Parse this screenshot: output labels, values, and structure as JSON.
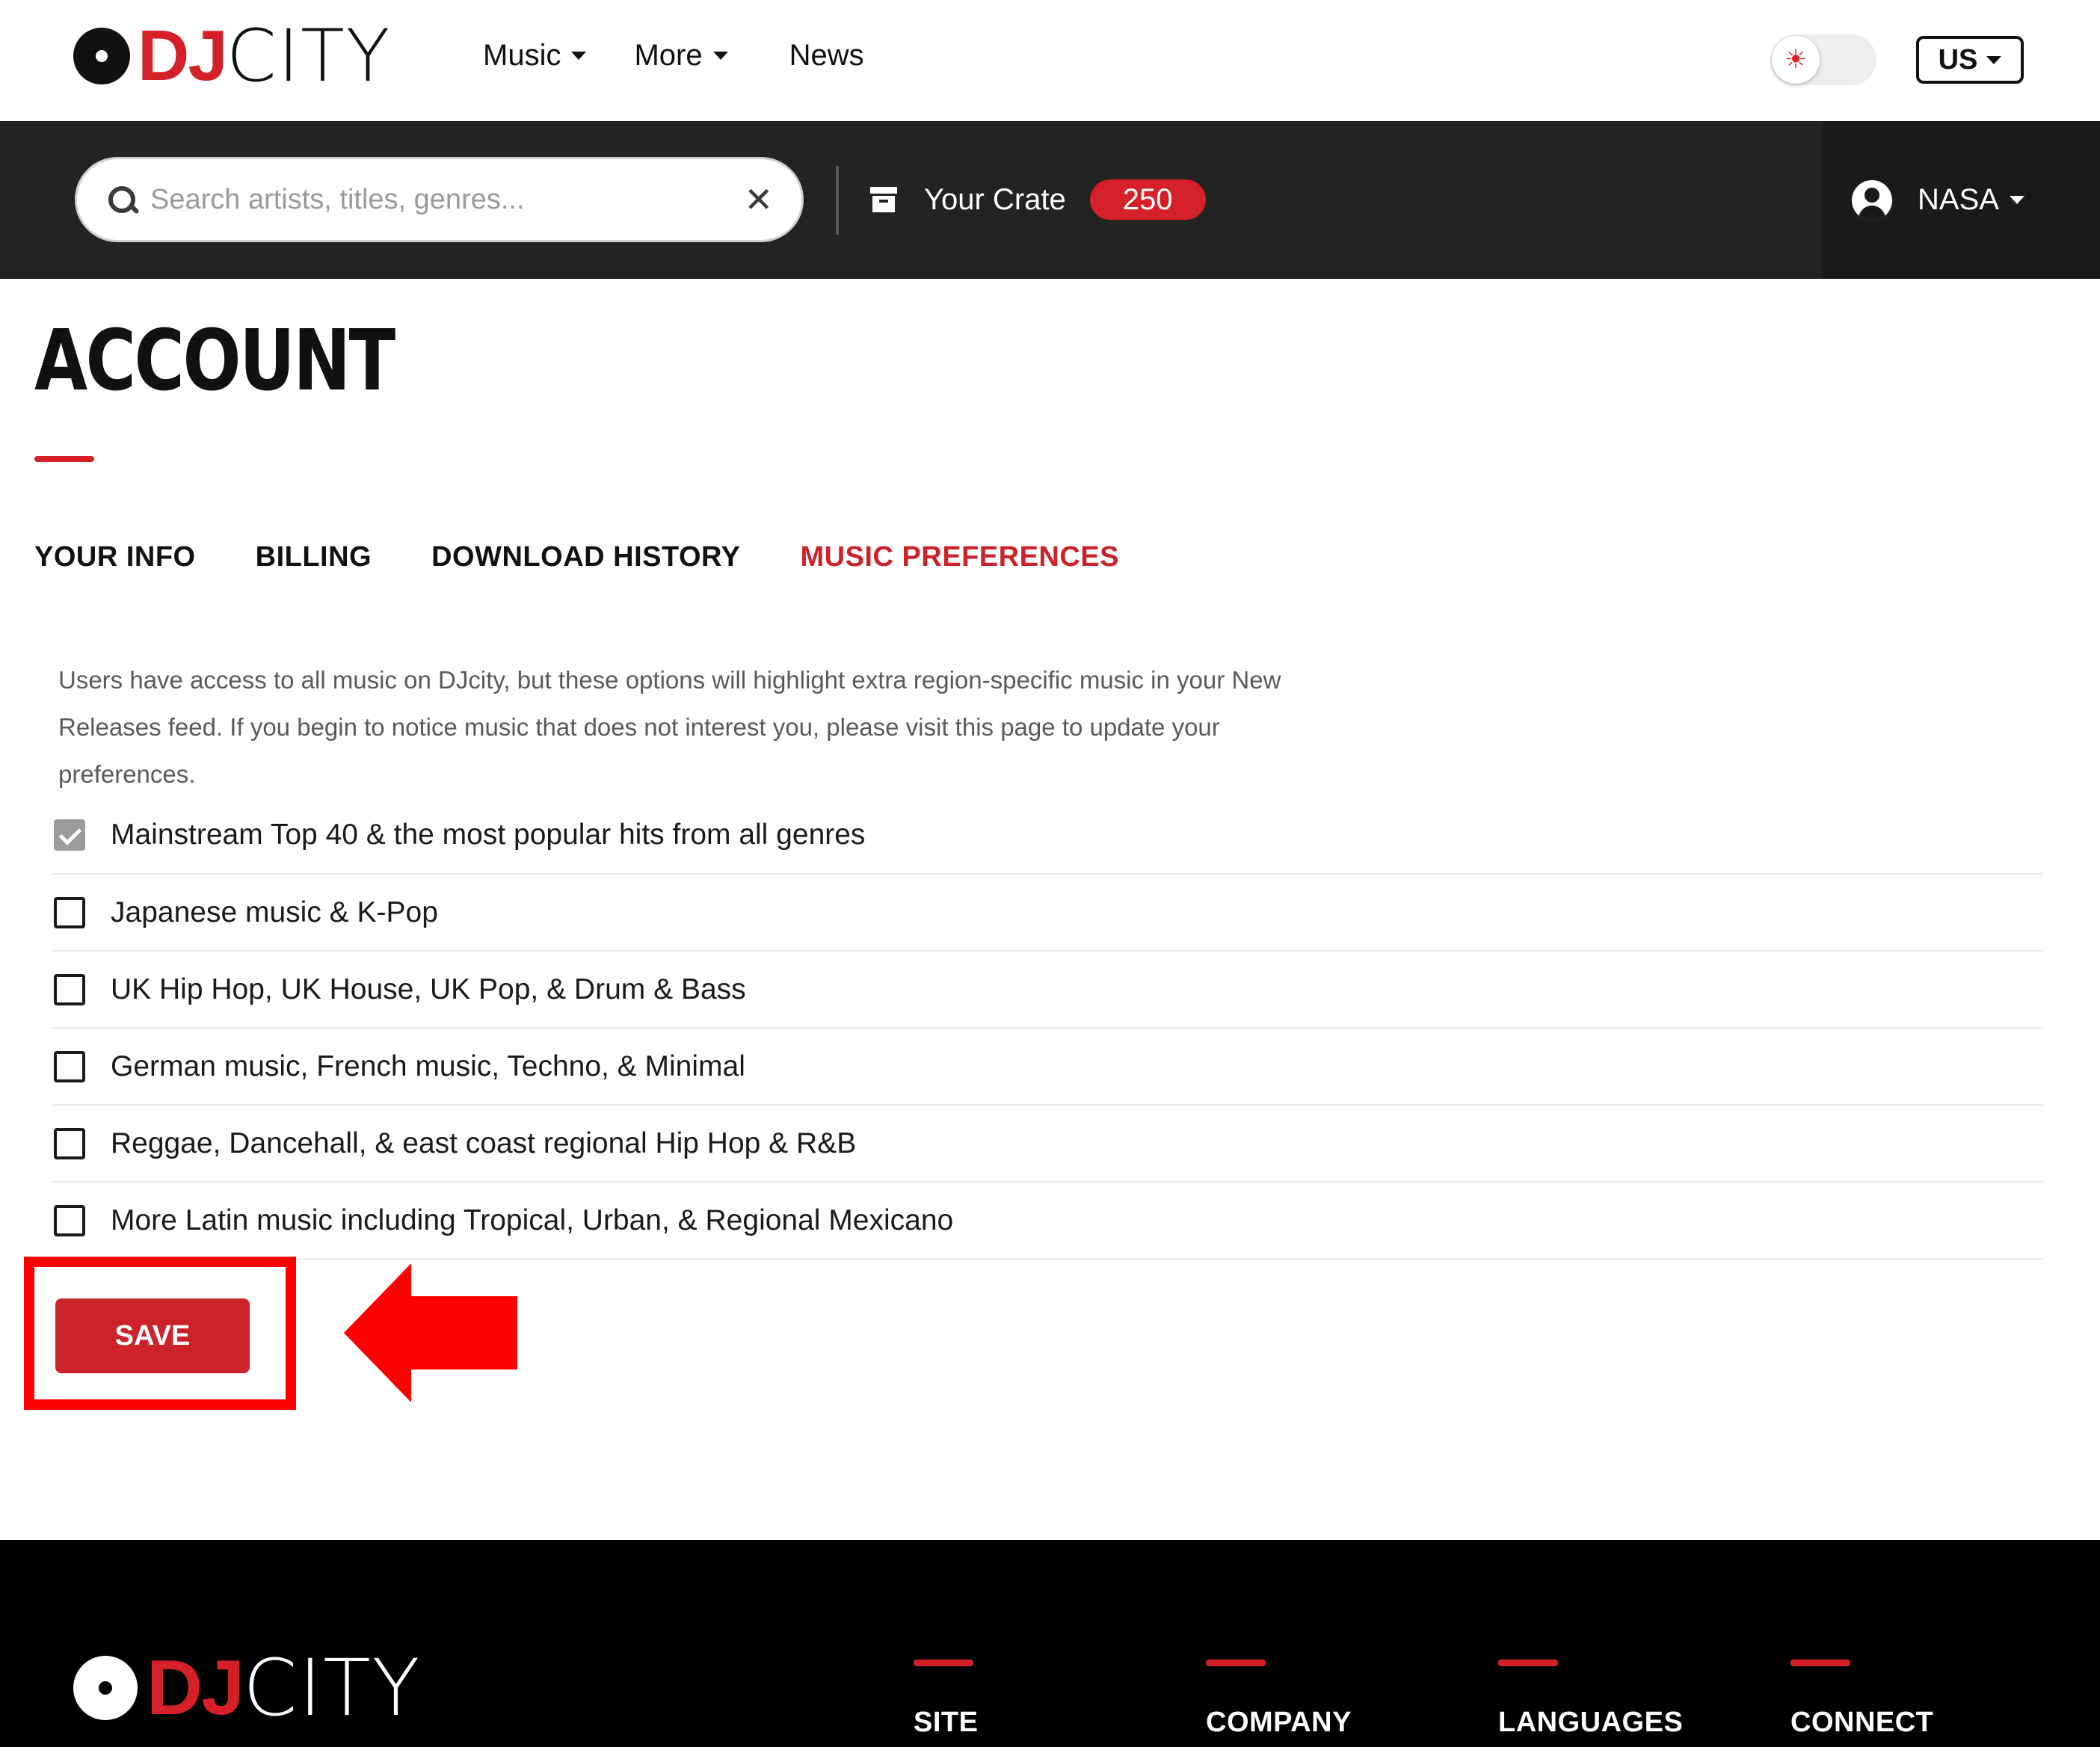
{
  "brand": {
    "logo_dj": "DJ",
    "logo_city": "CITY"
  },
  "topnav": {
    "items": [
      {
        "label": "Music",
        "dropdown": true
      },
      {
        "label": "More",
        "dropdown": true
      },
      {
        "label": "News",
        "dropdown": false
      }
    ]
  },
  "theme_toggle": {
    "state": "light",
    "icon": "sun-icon"
  },
  "region": {
    "label": "US"
  },
  "search": {
    "placeholder": "Search artists, titles, genres...",
    "value": ""
  },
  "crate": {
    "label": "Your Crate",
    "count": "250"
  },
  "user": {
    "name": "NASA"
  },
  "page": {
    "title": "ACCOUNT"
  },
  "tabs": [
    {
      "label": "YOUR INFO",
      "active": false
    },
    {
      "label": "BILLING",
      "active": false
    },
    {
      "label": "DOWNLOAD HISTORY",
      "active": false
    },
    {
      "label": "MUSIC PREFERENCES",
      "active": true
    }
  ],
  "preferences": {
    "intro": "Users have access to all music on DJcity, but these options will highlight extra region-specific music in your New Releases feed. If you begin to notice music that does not interest you, please visit this page to update your preferences.",
    "options": [
      {
        "label": "Mainstream Top 40 & the most popular hits from all genres",
        "checked": true,
        "disabled": true
      },
      {
        "label": "Japanese music & K-Pop",
        "checked": false
      },
      {
        "label": "UK Hip Hop, UK House, UK Pop, & Drum & Bass",
        "checked": false
      },
      {
        "label": "German music, French music, Techno, & Minimal",
        "checked": false
      },
      {
        "label": "Reggae, Dancehall, & east coast regional Hip Hop & R&B",
        "checked": false
      },
      {
        "label": "More Latin music including Tropical, Urban, & Regional Mexicano",
        "checked": false
      }
    ],
    "save_label": "SAVE"
  },
  "annotation": {
    "highlight_color": "#ff0000",
    "arrow_color": "#ff0000"
  },
  "footer": {
    "logo_dj": "DJ",
    "logo_city": "CITY",
    "columns": [
      "SITE",
      "COMPANY",
      "LANGUAGES",
      "CONNECT"
    ]
  },
  "colors": {
    "brand_red": "#d62027",
    "active_tab": "#cc2229",
    "dark_bar": "#232323"
  }
}
